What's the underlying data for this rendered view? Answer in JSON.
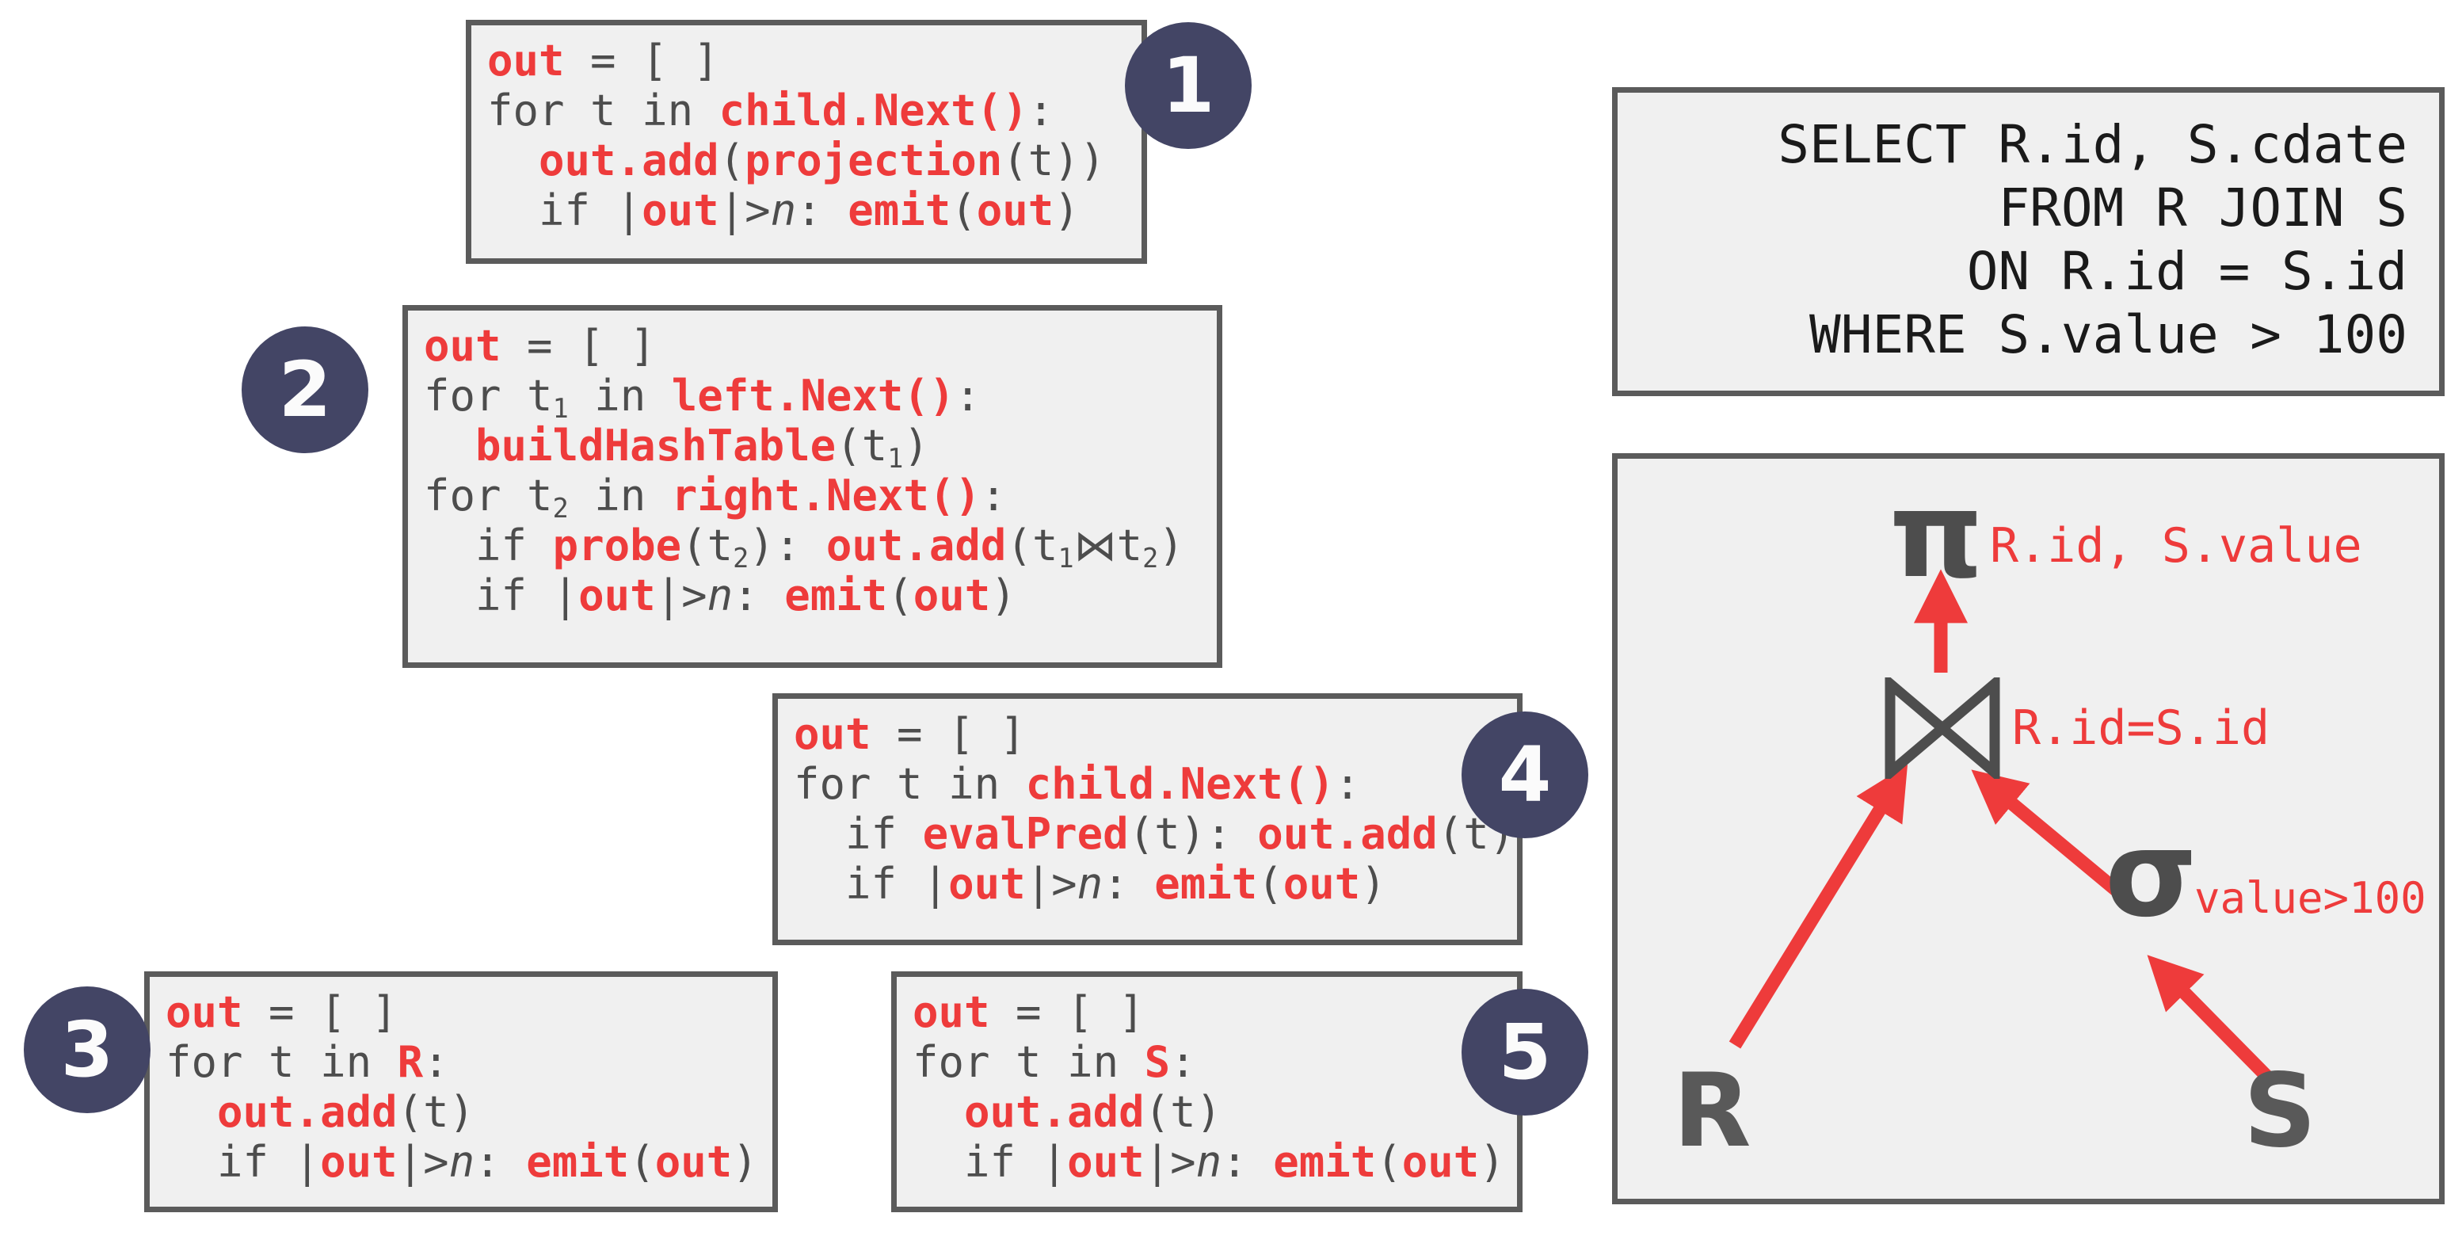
{
  "accent": {
    "red": "#ee3b3b",
    "badge_navy": "#434565",
    "box_border": "#5b5b5b",
    "box_fill": "#f0f0f0",
    "code_gray": "#4d4d4d"
  },
  "code_boxes": [
    {
      "number": "1",
      "operator": "projection",
      "lines": [
        [
          {
            "t": "out",
            "c": "red"
          },
          {
            "t": " = [ ]",
            "c": "gray"
          }
        ],
        [
          {
            "t": "for ",
            "c": "gray"
          },
          {
            "t": "t",
            "c": "gray"
          },
          {
            "t": " in ",
            "c": "gray"
          },
          {
            "t": "child.Next()",
            "c": "red"
          },
          {
            "t": ":",
            "c": "gray"
          }
        ],
        [
          {
            "t": "  ",
            "c": "gray"
          },
          {
            "t": "out.add",
            "c": "red"
          },
          {
            "t": "(",
            "c": "gray"
          },
          {
            "t": "projection",
            "c": "red"
          },
          {
            "t": "(t))",
            "c": "gray"
          }
        ],
        [
          {
            "t": "  if |",
            "c": "gray"
          },
          {
            "t": "out",
            "c": "red"
          },
          {
            "t": "|>",
            "c": "gray"
          },
          {
            "t": "n",
            "c": "gray-italic"
          },
          {
            "t": ": ",
            "c": "gray"
          },
          {
            "t": "emit",
            "c": "red"
          },
          {
            "t": "(",
            "c": "gray"
          },
          {
            "t": "out",
            "c": "red"
          },
          {
            "t": ")",
            "c": "gray"
          }
        ]
      ]
    },
    {
      "number": "2",
      "operator": "hash join",
      "lines": [
        [
          {
            "t": "out",
            "c": "red"
          },
          {
            "t": " = [ ]",
            "c": "gray"
          }
        ],
        [
          {
            "t": "for ",
            "c": "gray"
          },
          {
            "t": "t1",
            "c": "gray-sub"
          },
          {
            "t": " in ",
            "c": "gray"
          },
          {
            "t": "left.Next()",
            "c": "red"
          },
          {
            "t": ":",
            "c": "gray"
          }
        ],
        [
          {
            "t": "  ",
            "c": "gray"
          },
          {
            "t": "buildHashTable",
            "c": "red"
          },
          {
            "t": "(t1)",
            "c": "gray-sub"
          }
        ],
        [
          {
            "t": "for ",
            "c": "gray"
          },
          {
            "t": "t2",
            "c": "gray-sub"
          },
          {
            "t": " in ",
            "c": "gray"
          },
          {
            "t": "right.Next()",
            "c": "red"
          },
          {
            "t": ":",
            "c": "gray"
          }
        ],
        [
          {
            "t": "  if ",
            "c": "gray"
          },
          {
            "t": "probe",
            "c": "red"
          },
          {
            "t": "(t2): ",
            "c": "gray-sub"
          },
          {
            "t": "out.add",
            "c": "red"
          },
          {
            "t": "(t1⋈t2)",
            "c": "gray-sub"
          }
        ],
        [
          {
            "t": "  if |",
            "c": "gray"
          },
          {
            "t": "out",
            "c": "red"
          },
          {
            "t": "|>",
            "c": "gray"
          },
          {
            "t": "n",
            "c": "gray-italic"
          },
          {
            "t": ": ",
            "c": "gray"
          },
          {
            "t": "emit",
            "c": "red"
          },
          {
            "t": "(",
            "c": "gray"
          },
          {
            "t": "out",
            "c": "red"
          },
          {
            "t": ")",
            "c": "gray"
          }
        ]
      ]
    },
    {
      "number": "3",
      "operator": "scan R",
      "lines": [
        [
          {
            "t": "out",
            "c": "red"
          },
          {
            "t": " = [ ]",
            "c": "gray"
          }
        ],
        [
          {
            "t": "for t in ",
            "c": "gray"
          },
          {
            "t": "R",
            "c": "red"
          },
          {
            "t": ":",
            "c": "gray"
          }
        ],
        [
          {
            "t": "  ",
            "c": "gray"
          },
          {
            "t": "out.add",
            "c": "red"
          },
          {
            "t": "(t)",
            "c": "gray"
          }
        ],
        [
          {
            "t": "  if |",
            "c": "gray"
          },
          {
            "t": "out",
            "c": "red"
          },
          {
            "t": "|>",
            "c": "gray"
          },
          {
            "t": "n",
            "c": "gray-italic"
          },
          {
            "t": ": ",
            "c": "gray"
          },
          {
            "t": "emit",
            "c": "red"
          },
          {
            "t": "(",
            "c": "gray"
          },
          {
            "t": "out",
            "c": "red"
          },
          {
            "t": ")",
            "c": "gray"
          }
        ]
      ]
    },
    {
      "number": "4",
      "operator": "selection",
      "lines": [
        [
          {
            "t": "out",
            "c": "red"
          },
          {
            "t": " = [ ]",
            "c": "gray"
          }
        ],
        [
          {
            "t": "for t in ",
            "c": "gray"
          },
          {
            "t": "child.Next()",
            "c": "red"
          },
          {
            "t": ":",
            "c": "gray"
          }
        ],
        [
          {
            "t": "  if ",
            "c": "gray"
          },
          {
            "t": "evalPred",
            "c": "red"
          },
          {
            "t": "(t): ",
            "c": "gray"
          },
          {
            "t": "out.add",
            "c": "red"
          },
          {
            "t": "(t)",
            "c": "gray"
          }
        ],
        [
          {
            "t": "  if |",
            "c": "gray"
          },
          {
            "t": "out",
            "c": "red"
          },
          {
            "t": "|>",
            "c": "gray"
          },
          {
            "t": "n",
            "c": "gray-italic"
          },
          {
            "t": ": ",
            "c": "gray"
          },
          {
            "t": "emit",
            "c": "red"
          },
          {
            "t": "(",
            "c": "gray"
          },
          {
            "t": "out",
            "c": "red"
          },
          {
            "t": ")",
            "c": "gray"
          }
        ]
      ]
    },
    {
      "number": "5",
      "operator": "scan S",
      "lines": [
        [
          {
            "t": "out",
            "c": "red"
          },
          {
            "t": " = [ ]",
            "c": "gray"
          }
        ],
        [
          {
            "t": "for t in ",
            "c": "gray"
          },
          {
            "t": "S",
            "c": "red"
          },
          {
            "t": ":",
            "c": "gray"
          }
        ],
        [
          {
            "t": "  ",
            "c": "gray"
          },
          {
            "t": "out.add",
            "c": "red"
          },
          {
            "t": "(t)",
            "c": "gray"
          }
        ],
        [
          {
            "t": "  if |",
            "c": "gray"
          },
          {
            "t": "out",
            "c": "red"
          },
          {
            "t": "|>",
            "c": "gray"
          },
          {
            "t": "n",
            "c": "gray-italic"
          },
          {
            "t": ": ",
            "c": "gray"
          },
          {
            "t": "emit",
            "c": "red"
          },
          {
            "t": "(",
            "c": "gray"
          },
          {
            "t": "out",
            "c": "red"
          },
          {
            "t": ")",
            "c": "gray"
          }
        ]
      ]
    }
  ],
  "sql": {
    "lines": [
      "SELECT R.id, S.cdate",
      "FROM R JOIN S",
      "ON R.id = S.id",
      "WHERE S.value > 100"
    ]
  },
  "plan": {
    "projection_symbol": "π",
    "projection_label": "R.id, S.value",
    "join_label": "R.id=S.id",
    "selection_symbol": "σ",
    "selection_label": "value>100",
    "left_relation": "R",
    "right_relation": "S"
  }
}
